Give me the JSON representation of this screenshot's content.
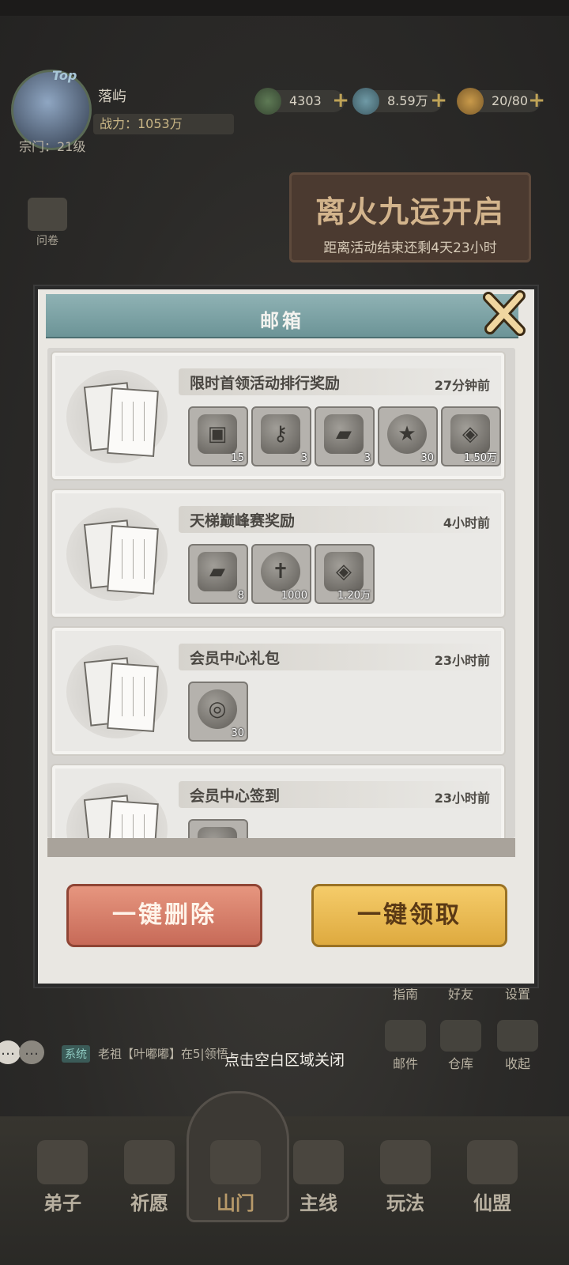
{
  "player": {
    "badge": "Top",
    "name": "落屿",
    "power": "战力：1053万",
    "sect": "宗门：21级"
  },
  "resources": [
    {
      "icon": "jade-coin-icon",
      "value": "4303"
    },
    {
      "icon": "spirit-stone-icon",
      "value": "8.59万"
    },
    {
      "icon": "stamina-gourd-icon",
      "value": "20/80"
    }
  ],
  "side_menu": {
    "survey_label": "问卷"
  },
  "event": {
    "title": "离火九运开启",
    "countdown": "距离活动结束还剩4天23小时"
  },
  "right_menu": {
    "guide": "指南",
    "friends": "好友",
    "settings": "设置",
    "mail": "邮件",
    "warehouse": "仓库",
    "collapse": "收起"
  },
  "chat": {
    "tag": "系统",
    "message": "老祖【叶嘟嘟】在5|领悟 ..."
  },
  "close_hint": "点击空白区域关闭",
  "bottom_nav": [
    "弟子",
    "祈愿",
    "山门",
    "主线",
    "玩法",
    "仙盟"
  ],
  "mailbox": {
    "title": "邮箱",
    "mails": [
      {
        "title": "限时首领活动排行奖励",
        "time": "27分钟前",
        "rewards": [
          {
            "icon": "treasure-chest-icon",
            "count": "15"
          },
          {
            "icon": "key-icon",
            "count": "3"
          },
          {
            "icon": "scroll-ticket-icon",
            "count": "3"
          },
          {
            "icon": "star-coin-icon",
            "count": "30"
          },
          {
            "icon": "spirit-stone-icon",
            "count": "1.50万"
          }
        ]
      },
      {
        "title": "天梯巅峰赛奖励",
        "time": "4小时前",
        "rewards": [
          {
            "icon": "scroll-ticket-icon",
            "count": "8"
          },
          {
            "icon": "sword-emblem-icon",
            "count": "1000"
          },
          {
            "icon": "spirit-stone-icon",
            "count": "1.20万"
          }
        ]
      },
      {
        "title": "会员中心礼包",
        "time": "23小时前",
        "rewards": [
          {
            "icon": "jade-coin-icon",
            "count": "30"
          }
        ]
      },
      {
        "title": "会员中心签到",
        "time": "23小时前",
        "rewards": [
          {
            "icon": "reward-item-icon",
            "count": ""
          }
        ]
      }
    ],
    "delete_all_label": "一键删除",
    "claim_all_label": "一键领取"
  }
}
